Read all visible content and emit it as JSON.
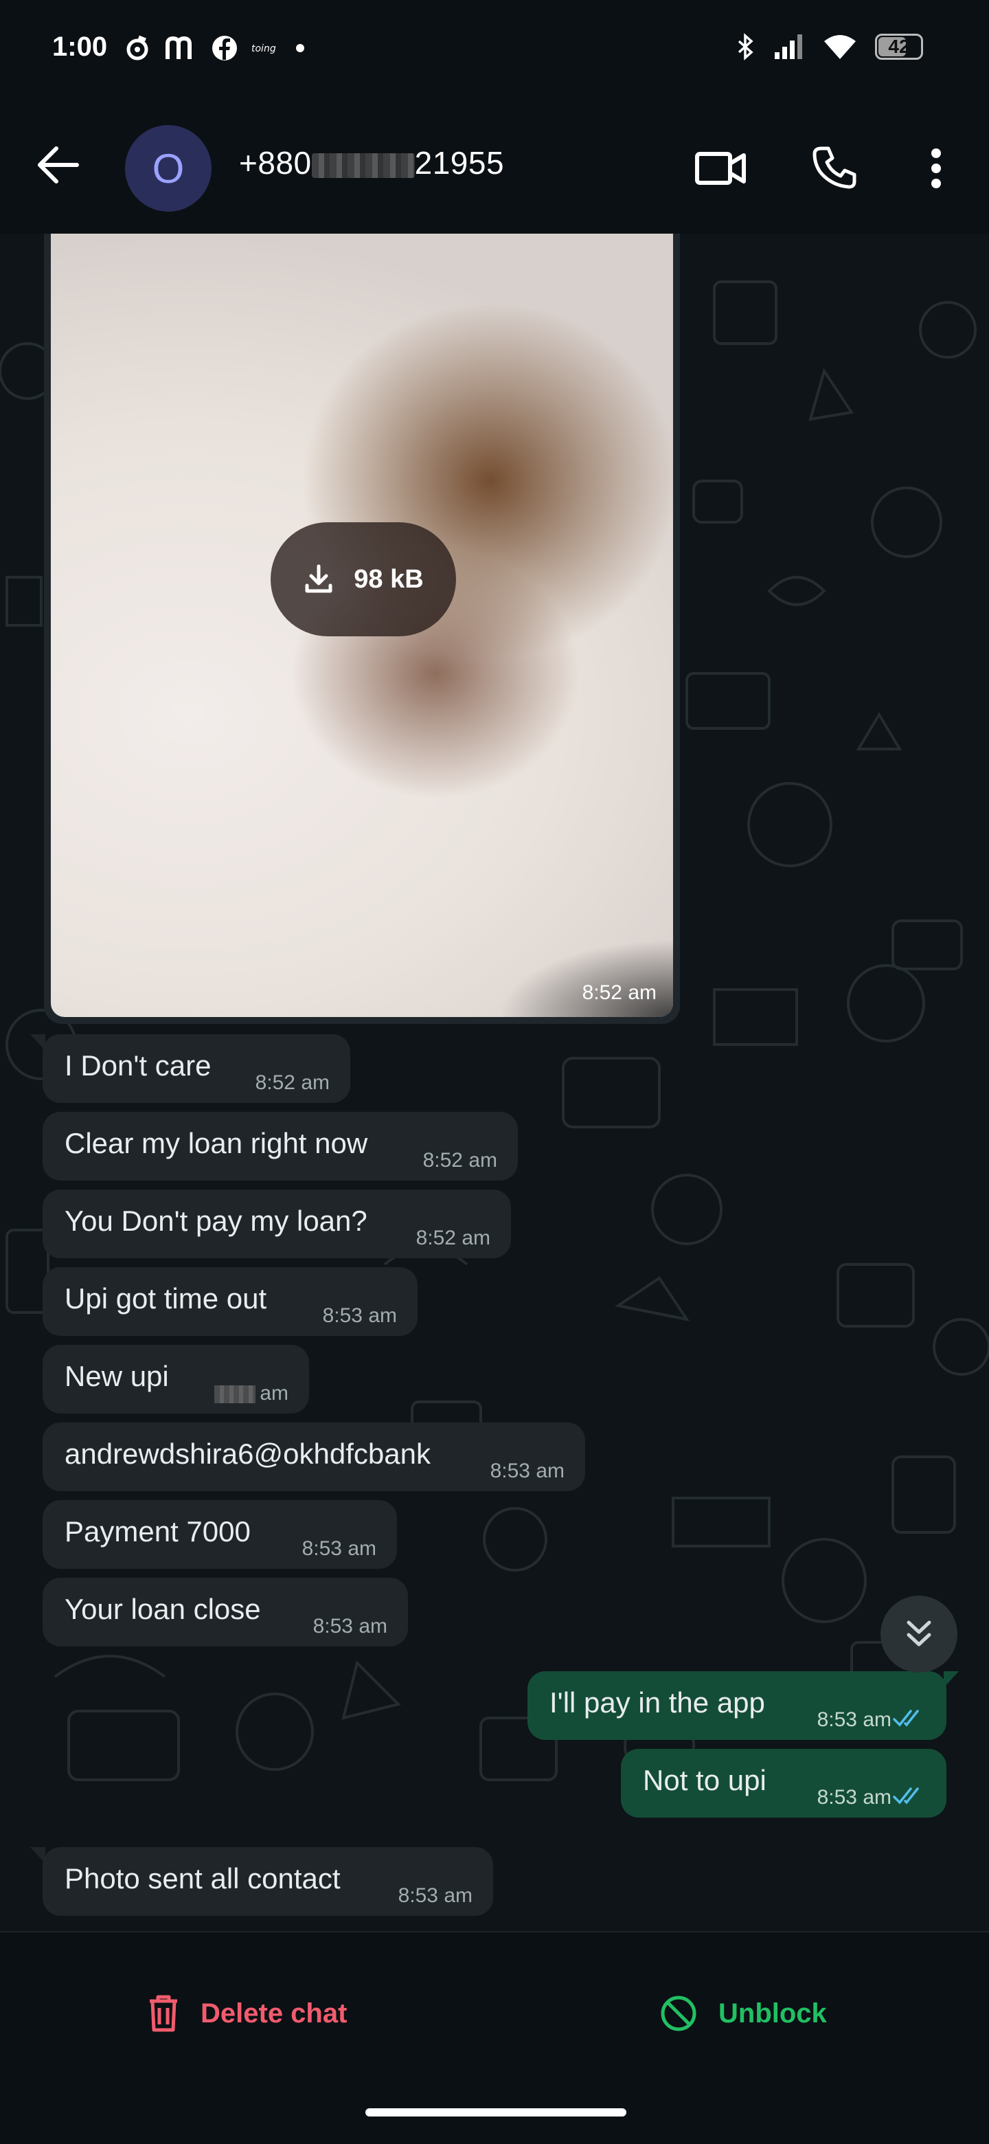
{
  "status_bar": {
    "time": "1:00",
    "battery": "42",
    "left_icons": [
      "alarm-icon",
      "m-icon",
      "facebook-icon",
      "toing-icon",
      "dot-icon"
    ],
    "right_icons": [
      "bluetooth-icon",
      "signal-icon",
      "wifi-icon",
      "battery-icon"
    ]
  },
  "header": {
    "avatar_letter": "O",
    "contact_prefix": "+880",
    "contact_suffix": "21955",
    "icons": [
      "back-arrow-icon",
      "video-call-icon",
      "phone-icon",
      "more-vert-icon"
    ]
  },
  "image_message": {
    "download_size": "98 kB",
    "time": "8:52 am"
  },
  "messages": [
    {
      "direction": "in",
      "text": "I Don't care",
      "time": "8:52 am"
    },
    {
      "direction": "in",
      "text": "Clear my loan right now",
      "time": "8:52 am"
    },
    {
      "direction": "in",
      "text": "You Don't pay my loan?",
      "time": "8:52 am"
    },
    {
      "direction": "in",
      "text": "Upi got time out",
      "time": "8:53 am"
    },
    {
      "direction": "in",
      "text": "New upi",
      "time": "am"
    },
    {
      "direction": "in",
      "text": "andrewdshira6@okhdfcbank",
      "time": "8:53 am"
    },
    {
      "direction": "in",
      "text": "Payment 7000",
      "time": "8:53 am"
    },
    {
      "direction": "in",
      "text": "Your loan close",
      "time": "8:53 am"
    },
    {
      "direction": "out",
      "text": "I'll pay in the app",
      "time": "8:53 am"
    },
    {
      "direction": "out",
      "text": "Not to upi",
      "time": "8:53 am"
    },
    {
      "direction": "in",
      "text": "Photo sent all contact",
      "time": "8:53 am"
    }
  ],
  "bottom_bar": {
    "delete_label": "Delete chat",
    "unblock_label": "Unblock"
  },
  "colors": {
    "incoming_bubble": "#1f2528",
    "outgoing_bubble": "#144d37",
    "delete_red": "#f15c6d",
    "unblock_green": "#21c063",
    "read_ticks": "#53bdeb"
  }
}
